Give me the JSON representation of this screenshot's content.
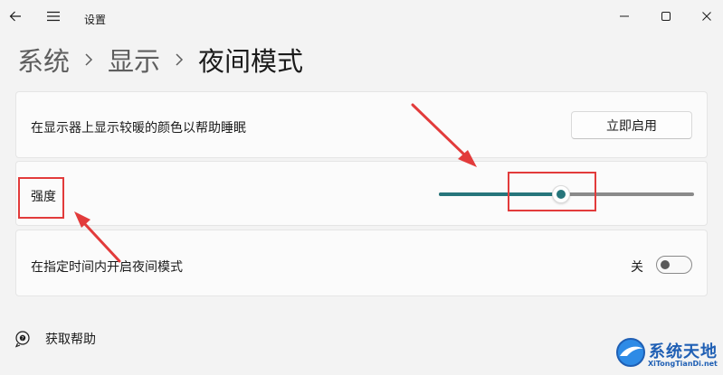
{
  "window": {
    "title": "设置"
  },
  "breadcrumb": {
    "items": [
      "系统",
      "显示",
      "夜间模式"
    ]
  },
  "settings": {
    "schedule_now": {
      "label": "在显示器上显示较暖的颜色以帮助睡眠",
      "button": "立即启用"
    },
    "strength": {
      "label": "强度",
      "value": 0.48
    },
    "schedule": {
      "label": "在指定时间内开启夜间模式",
      "state": "关",
      "on": false
    }
  },
  "help": {
    "label": "获取帮助"
  },
  "watermark": {
    "name": "系统天地",
    "url": "XiTongTianDi.net"
  },
  "colors": {
    "accent": "#26757b",
    "annotation": "#e23b3b",
    "watermark": "#1f5fb4"
  },
  "icons": [
    "back-arrow-icon",
    "hamburger-menu-icon",
    "minimize-icon",
    "maximize-icon",
    "close-icon",
    "chevron-right-icon",
    "help-icon"
  ]
}
